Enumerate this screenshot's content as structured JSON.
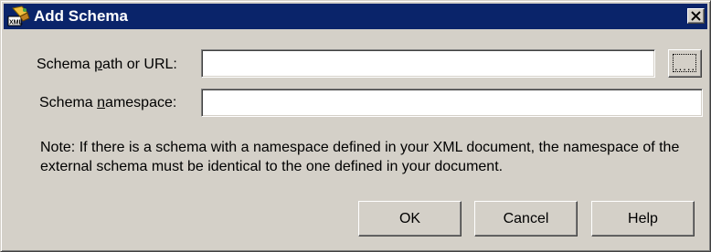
{
  "window": {
    "title": "Add Schema",
    "icon": "xml-schema-icon",
    "close_symbol": "×"
  },
  "fields": {
    "schema_path": {
      "label_before": "Schema ",
      "label_accel": "p",
      "label_after": "ath or URL:",
      "value": ""
    },
    "schema_namespace": {
      "label_before": "Schema ",
      "label_accel": "n",
      "label_after": "amespace:",
      "value": ""
    },
    "browse_button_label": "....."
  },
  "note": "Note: If there is a schema with a namespace defined in your XML document, the namespace of the external schema must be identical to the one defined in your document.",
  "buttons": {
    "ok": "OK",
    "cancel": "Cancel",
    "help": "Help"
  },
  "colors": {
    "titlebar": "#0a246a",
    "face": "#d4d0c8"
  }
}
